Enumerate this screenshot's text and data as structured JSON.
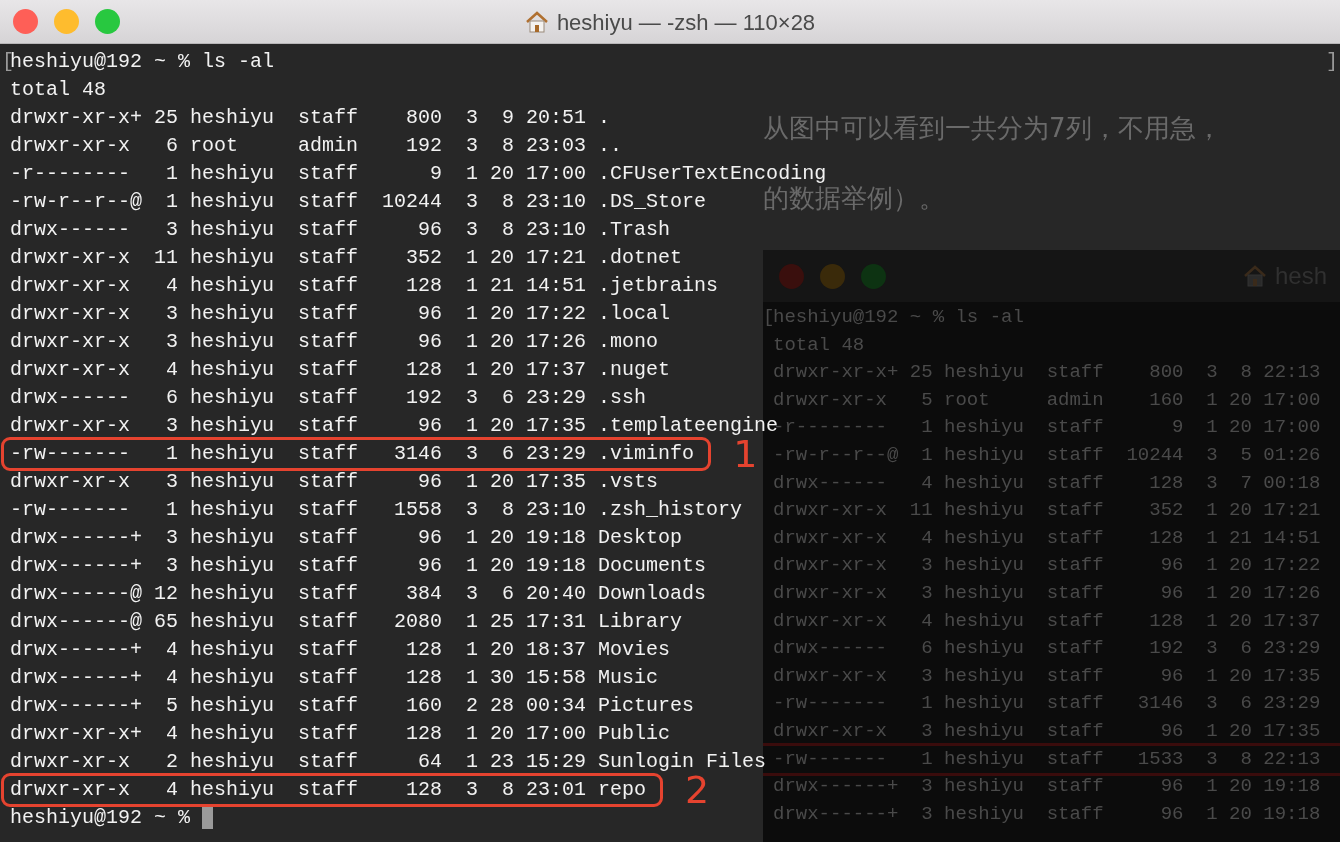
{
  "window": {
    "title": "heshiyu — -zsh — 110×28"
  },
  "terminal": {
    "open_mark": "[",
    "close_mark": "]",
    "prompt_line": "heshiyu@192 ~ % ls -al",
    "total": "total 48",
    "rows": [
      {
        "line": "drwxr-xr-x+ 25 heshiyu  staff    800  3  9 20:51 ."
      },
      {
        "line": "drwxr-xr-x   6 root     admin    192  3  8 23:03 .."
      },
      {
        "line": "-r--------   1 heshiyu  staff      9  1 20 17:00 .CFUserTextEncoding"
      },
      {
        "line": "-rw-r--r--@  1 heshiyu  staff  10244  3  8 23:10 .DS_Store"
      },
      {
        "line": "drwx------   3 heshiyu  staff     96  3  8 23:10 .Trash"
      },
      {
        "line": "drwxr-xr-x  11 heshiyu  staff    352  1 20 17:21 .dotnet"
      },
      {
        "line": "drwxr-xr-x   4 heshiyu  staff    128  1 21 14:51 .jetbrains"
      },
      {
        "line": "drwxr-xr-x   3 heshiyu  staff     96  1 20 17:22 .local"
      },
      {
        "line": "drwxr-xr-x   3 heshiyu  staff     96  1 20 17:26 .mono"
      },
      {
        "line": "drwxr-xr-x   4 heshiyu  staff    128  1 20 17:37 .nuget"
      },
      {
        "line": "drwx------   6 heshiyu  staff    192  3  6 23:29 .ssh"
      },
      {
        "line": "drwxr-xr-x   3 heshiyu  staff     96  1 20 17:35 .templateengine"
      },
      {
        "line": "-rw-------   1 heshiyu  staff   3146  3  6 23:29 .viminfo",
        "annotation": "1"
      },
      {
        "line": "drwxr-xr-x   3 heshiyu  staff     96  1 20 17:35 .vsts"
      },
      {
        "line": "-rw-------   1 heshiyu  staff   1558  3  8 23:10 .zsh_history"
      },
      {
        "line": "drwx------+  3 heshiyu  staff     96  1 20 19:18 Desktop"
      },
      {
        "line": "drwx------+  3 heshiyu  staff     96  1 20 19:18 Documents"
      },
      {
        "line": "drwx------@ 12 heshiyu  staff    384  3  6 20:40 Downloads"
      },
      {
        "line": "drwx------@ 65 heshiyu  staff   2080  1 25 17:31 Library"
      },
      {
        "line": "drwx------+  4 heshiyu  staff    128  1 20 18:37 Movies"
      },
      {
        "line": "drwx------+  4 heshiyu  staff    128  1 30 15:58 Music"
      },
      {
        "line": "drwx------+  5 heshiyu  staff    160  2 28 00:34 Pictures"
      },
      {
        "line": "drwxr-xr-x+  4 heshiyu  staff    128  1 20 17:00 Public"
      },
      {
        "line": "drwxr-xr-x   2 heshiyu  staff     64  1 23 15:29 Sunlogin Files"
      },
      {
        "line": "drwxr-xr-x   4 heshiyu  staff    128  3  8 23:01 repo",
        "annotation": "2"
      }
    ],
    "final_prompt": "heshiyu@192 ~ %"
  },
  "background": {
    "paragraph": [
      "从图中可以看到一共分为7列，不用急，",
      "的数据举例）。"
    ],
    "screenshot": {
      "title": "hesh",
      "open_mark": "[",
      "prompt_line": "heshiyu@192 ~ % ls -al",
      "total": "total 48",
      "rows": [
        {
          "line": "drwxr-xr-x+ 25 heshiyu  staff    800  3  8 22:13",
          "marked": false
        },
        {
          "line": "drwxr-xr-x   5 root     admin    160  1 20 17:00",
          "marked": false
        },
        {
          "line": "-r--------   1 heshiyu  staff      9  1 20 17:00",
          "marked": false
        },
        {
          "line": "-rw-r--r--@  1 heshiyu  staff  10244  3  5 01:26",
          "marked": false
        },
        {
          "line": "drwx------   4 heshiyu  staff    128  3  7 00:18",
          "marked": false
        },
        {
          "line": "drwxr-xr-x  11 heshiyu  staff    352  1 20 17:21",
          "marked": false
        },
        {
          "line": "drwxr-xr-x   4 heshiyu  staff    128  1 21 14:51",
          "marked": false
        },
        {
          "line": "drwxr-xr-x   3 heshiyu  staff     96  1 20 17:22",
          "marked": false
        },
        {
          "line": "drwxr-xr-x   3 heshiyu  staff     96  1 20 17:26",
          "marked": false
        },
        {
          "line": "drwxr-xr-x   4 heshiyu  staff    128  1 20 17:37",
          "marked": false
        },
        {
          "line": "drwx------   6 heshiyu  staff    192  3  6 23:29",
          "marked": false
        },
        {
          "line": "drwxr-xr-x   3 heshiyu  staff     96  1 20 17:35",
          "marked": false
        },
        {
          "line": "-rw-------   1 heshiyu  staff   3146  3  6 23:29",
          "marked": false
        },
        {
          "line": "drwxr-xr-x   3 heshiyu  staff     96  1 20 17:35",
          "marked": false
        },
        {
          "line": "-rw-------   1 heshiyu  staff   1533  3  8 22:13",
          "marked": true
        },
        {
          "line": "drwx------+  3 heshiyu  staff     96  1 20 19:18",
          "marked": false
        },
        {
          "line": "drwx------+  3 heshiyu  staff     96  1 20 19:18",
          "marked": false
        }
      ]
    }
  }
}
